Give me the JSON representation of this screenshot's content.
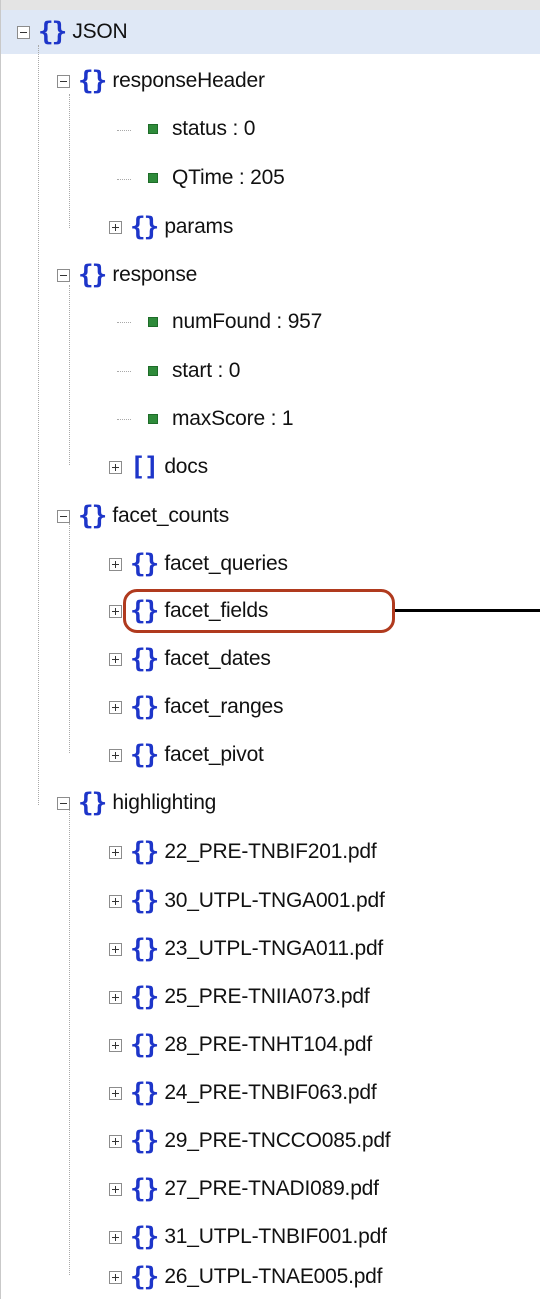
{
  "tree": {
    "root": {
      "label": "JSON"
    },
    "responseHeader": {
      "label": "responseHeader",
      "children": [
        {
          "key": "status",
          "sep": " : ",
          "value": "0"
        },
        {
          "key": "QTime",
          "sep": " : ",
          "value": "205"
        }
      ],
      "params": {
        "label": "params"
      }
    },
    "response": {
      "label": "response",
      "children": [
        {
          "key": "numFound",
          "sep": " : ",
          "value": "957"
        },
        {
          "key": "start",
          "sep": " : ",
          "value": "0"
        },
        {
          "key": "maxScore",
          "sep": " : ",
          "value": "1"
        }
      ],
      "docs": {
        "label": "docs"
      }
    },
    "facet_counts": {
      "label": "facet_counts",
      "children": [
        {
          "label": "facet_queries"
        },
        {
          "label": "facet_fields"
        },
        {
          "label": "facet_dates"
        },
        {
          "label": "facet_ranges"
        },
        {
          "label": "facet_pivot"
        }
      ]
    },
    "highlighting": {
      "label": "highlighting",
      "children": [
        {
          "label": "22_PRE-TNBIF201.pdf"
        },
        {
          "label": "30_UTPL-TNGA001.pdf"
        },
        {
          "label": "23_UTPL-TNGA011.pdf"
        },
        {
          "label": "25_PRE-TNIIA073.pdf"
        },
        {
          "label": "28_PRE-TNHT104.pdf"
        },
        {
          "label": "24_PRE-TNBIF063.pdf"
        },
        {
          "label": "29_PRE-TNCCO085.pdf"
        },
        {
          "label": "27_PRE-TNADI089.pdf"
        },
        {
          "label": "31_UTPL-TNBIF001.pdf"
        },
        {
          "label": "26_UTPL-TNAE005.pdf"
        }
      ]
    }
  },
  "icons": {
    "object": "object-braces-icon",
    "array": "array-brackets-icon",
    "leaf": "leaf-value-icon",
    "collapse": "collapse-icon",
    "expand": "expand-icon"
  },
  "colors": {
    "icon_blue": "#1d35c9",
    "leaf_green": "#2e8b3a",
    "callout_red": "#b03a1e",
    "root_highlight": "#dfe8f6"
  }
}
